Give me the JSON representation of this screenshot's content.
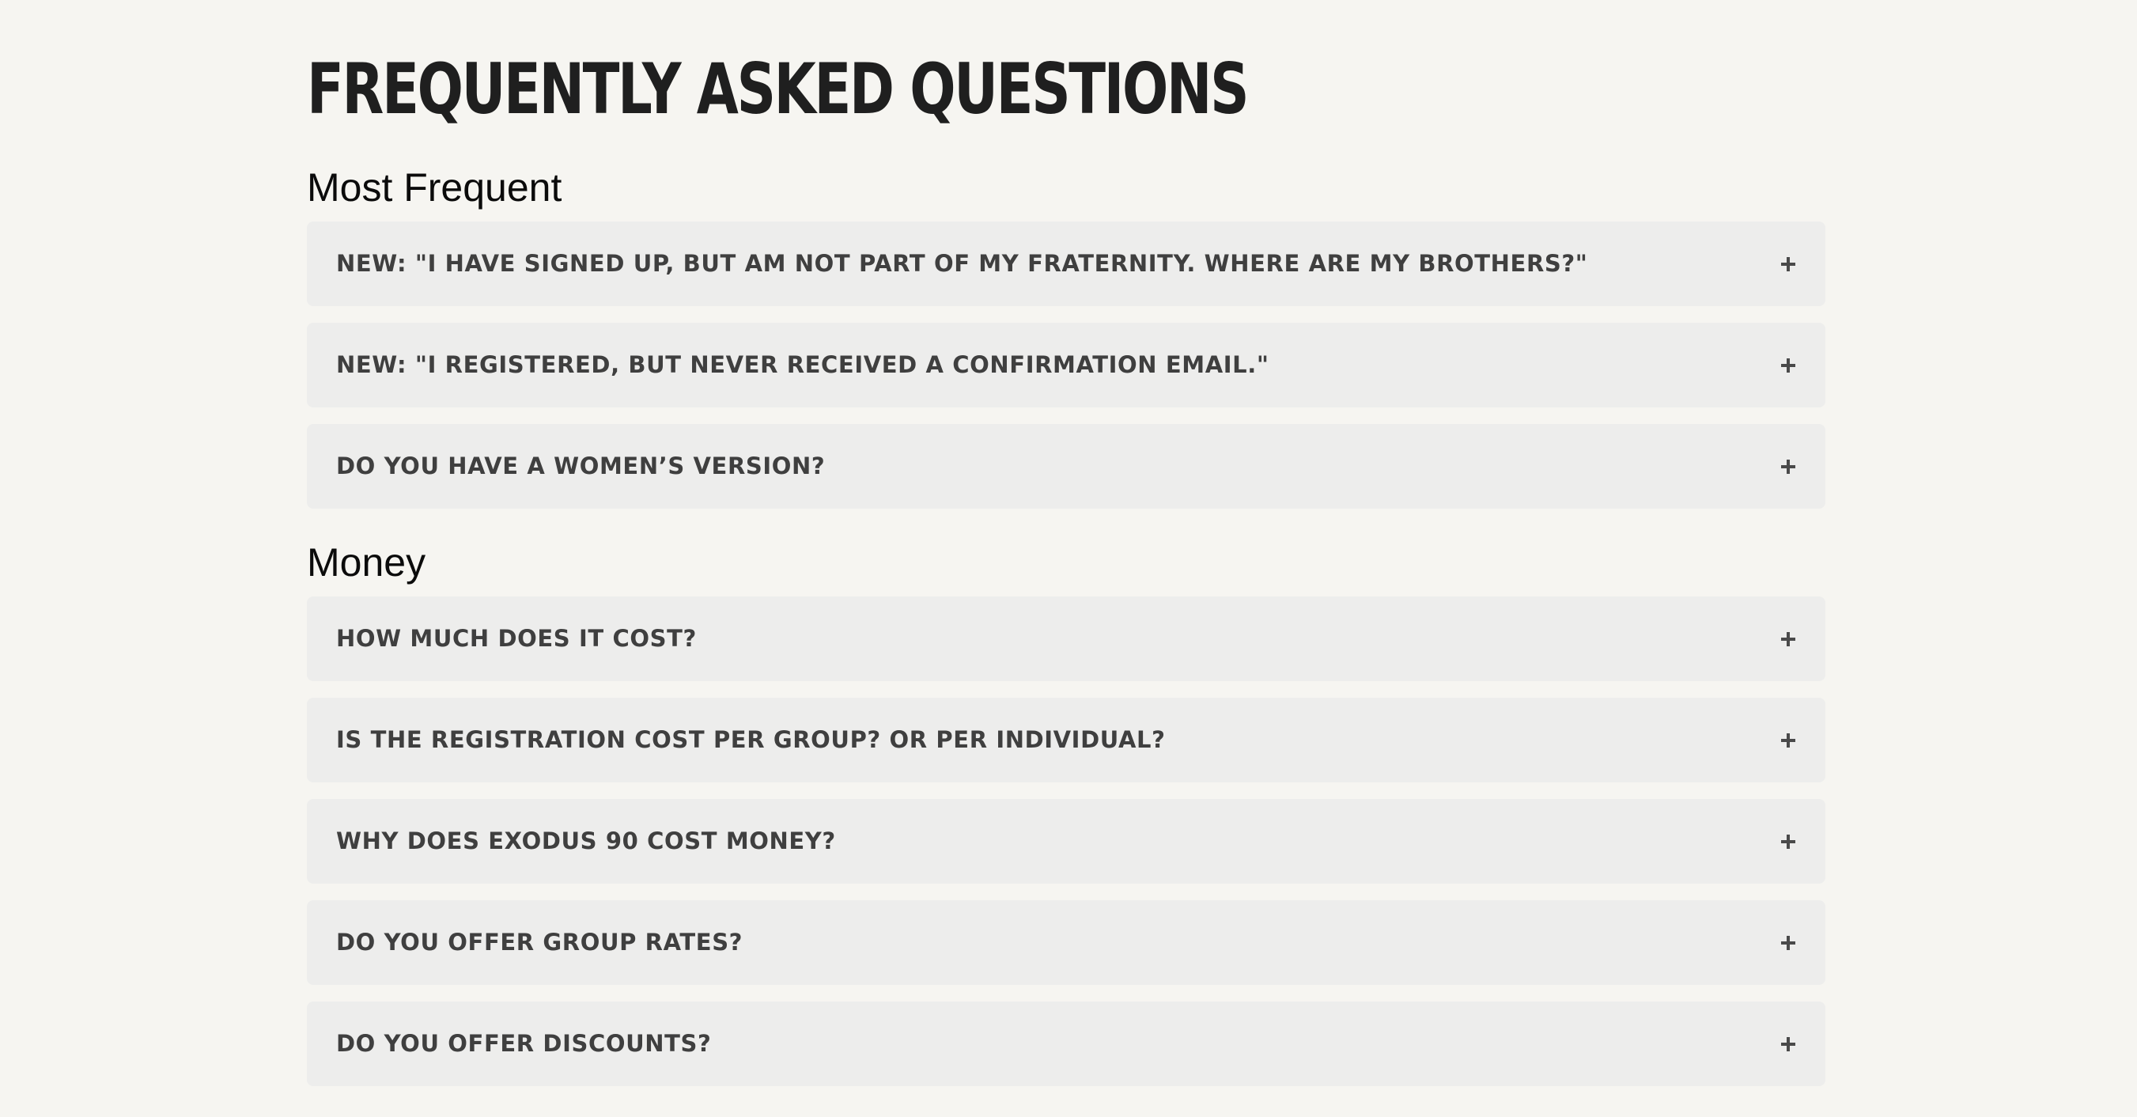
{
  "page": {
    "title": "FREQUENTLY ASKED QUESTIONS"
  },
  "sections": [
    {
      "heading": "Most Frequent",
      "items": [
        {
          "question": "NEW: \"I HAVE SIGNED UP, BUT AM NOT PART OF MY FRATERNITY. WHERE ARE MY BROTHERS?\"",
          "expanded": false
        },
        {
          "question": "NEW: \"I REGISTERED, BUT NEVER RECEIVED A CONFIRMATION EMAIL.\"",
          "expanded": false
        },
        {
          "question": "DO YOU HAVE A WOMEN’S VERSION?",
          "expanded": false
        }
      ]
    },
    {
      "heading": "Money",
      "items": [
        {
          "question": "HOW MUCH DOES IT COST?",
          "expanded": false
        },
        {
          "question": "IS THE REGISTRATION COST PER GROUP? OR PER INDIVIDUAL?",
          "expanded": false
        },
        {
          "question": "WHY DOES EXODUS 90 COST MONEY?",
          "expanded": false
        },
        {
          "question": "DO YOU OFFER GROUP RATES?",
          "expanded": false
        },
        {
          "question": "DO YOU OFFER DISCOUNTS?",
          "expanded": false
        }
      ]
    }
  ],
  "icons": {
    "accordion_toggle": "plus-icon"
  },
  "colors": {
    "page_background": "#f6f5f1",
    "item_background": "#ededec",
    "title_text": "#1f1f1f",
    "question_text": "#3f3f3f"
  }
}
